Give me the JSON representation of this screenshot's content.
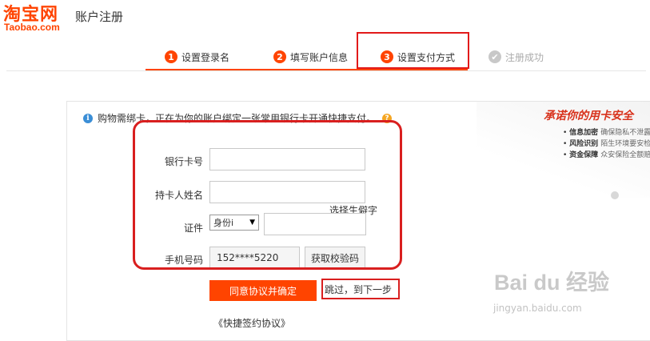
{
  "header": {
    "logo_cn": "淘宝网",
    "logo_en": "Taobao.com",
    "title": "账户注册"
  },
  "steps": [
    {
      "num": "1",
      "label": "设置登录名"
    },
    {
      "num": "2",
      "label": "填写账户信息"
    },
    {
      "num": "3",
      "label": "设置支付方式"
    },
    {
      "num": "✔",
      "label": "注册成功"
    }
  ],
  "notice": {
    "icon": "i",
    "text": "购物需绑卡，正在为你的账户绑定一张常用银行卡开通快捷支付。",
    "help_icon": "?"
  },
  "promise": {
    "title": "承诺你的用卡安全",
    "items": [
      {
        "label": "信息加密",
        "desc": "确保隐私不泄露"
      },
      {
        "label": "风险识别",
        "desc": "陌生环境要安检"
      },
      {
        "label": "资金保障",
        "desc": "众安保险全额赔"
      }
    ]
  },
  "form": {
    "card_number_label": "银行卡号",
    "card_number_value": "",
    "holder_label": "持卡人姓名",
    "holder_value": "",
    "choose_rare": "选择生僻字",
    "id_label": "证件",
    "id_type": "身份i",
    "id_value": "",
    "phone_label": "手机号码",
    "phone_value": "152****5220",
    "get_code": "获取校验码"
  },
  "actions": {
    "agree": "同意协议并确定",
    "skip": "跳过，到下一步",
    "agreement": "《快捷签约协议》"
  },
  "watermark": {
    "logo": "Bai du 经验",
    "url": "jingyan.baidu.com"
  },
  "colors": {
    "brand": "#ff4400",
    "annotation_red": "#d91f1f",
    "info_blue": "#3b8ed6",
    "help_orange": "#f5a623"
  }
}
